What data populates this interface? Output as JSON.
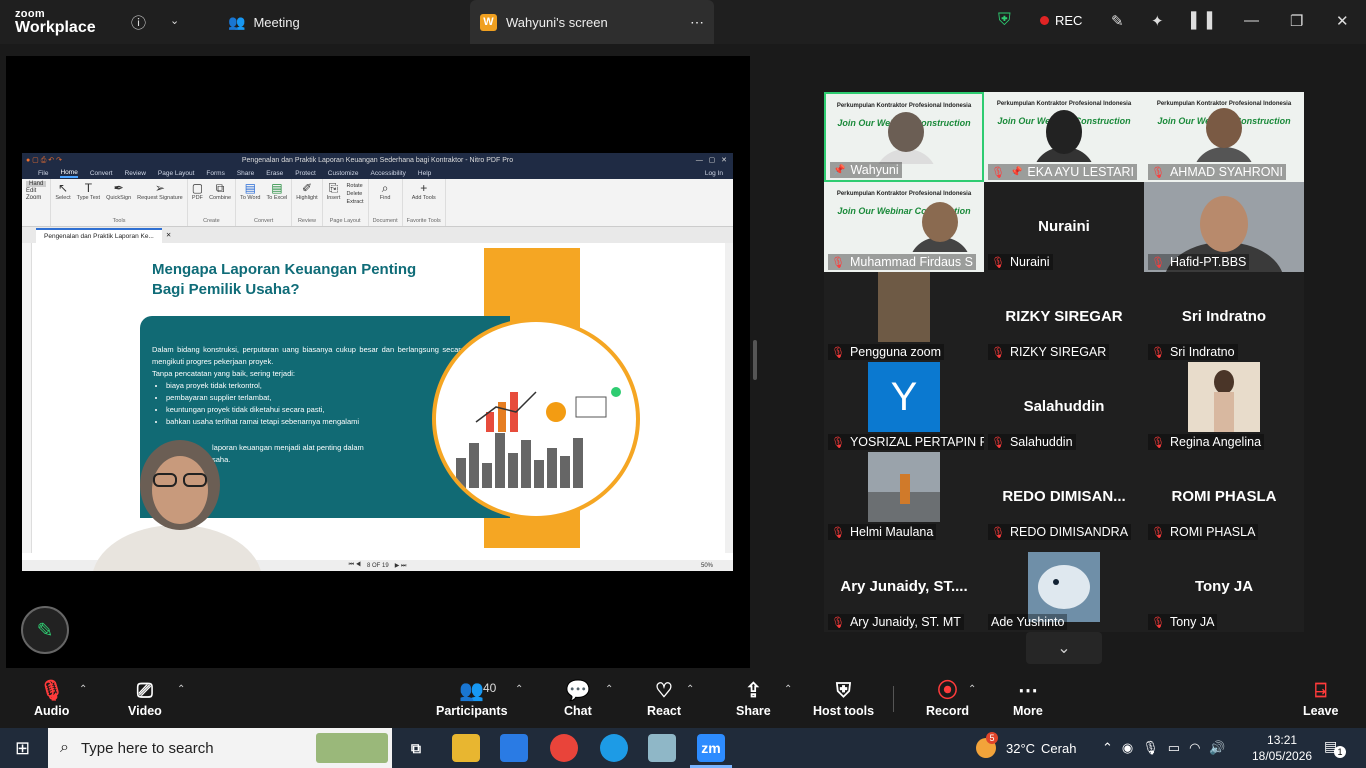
{
  "app": {
    "logo_line1": "zoom",
    "logo_line2": "Workplace"
  },
  "topbar": {
    "tabs": [
      {
        "label": "Meeting",
        "icon": "people-icon"
      },
      {
        "label": "Wahyuni's screen",
        "badge": "W",
        "icon": "screen-share-icon"
      }
    ],
    "rec_label": "REC",
    "colors": {
      "accent_green": "#2ecc71",
      "rec_red": "#e02424",
      "badge_orange": "#f0a020"
    }
  },
  "nitro": {
    "window_title": "Pengenalan dan Praktik Laporan Keuangan Sederhana bagi Kontraktor - Nitro PDF Pro",
    "menu": [
      "File",
      "Home",
      "Convert",
      "Review",
      "Page Layout",
      "Forms",
      "Share",
      "Erase",
      "Protect",
      "Customize",
      "Accessibility",
      "Help"
    ],
    "login": "Log In",
    "left_tools": [
      "Hand",
      "Edit",
      "Zoom"
    ],
    "ribbon_groups": [
      {
        "name": "Tools",
        "buttons": [
          "Select",
          "Type Text",
          "QuickSign",
          "Request Signature"
        ]
      },
      {
        "name": "Create",
        "buttons": [
          "PDF",
          "Combine"
        ]
      },
      {
        "name": "Convert",
        "buttons": [
          "To Word",
          "To Excel"
        ]
      },
      {
        "name": "Review",
        "buttons": [
          "Highlight"
        ]
      },
      {
        "name": "Page Layout",
        "buttons": [
          "Insert",
          "Rotate",
          "Delete",
          "Extract"
        ]
      },
      {
        "name": "Document",
        "buttons": [
          "Find"
        ]
      },
      {
        "name": "Favorite Tools",
        "buttons": [
          "Add Tools"
        ]
      }
    ],
    "doc_tab": "Pengenalan dan Praktik Laporan Ke...",
    "slide_title": "Mengapa Laporan Keuangan Penting Bagi Pemilik Usaha?",
    "slide_intro": "Dalam bidang konstruksi, perputaran uang biasanya cukup besar dan berlangsung secara bertahap mengikuti progres pekerjaan proyek.",
    "slide_lead": "Tanpa pencatatan yang baik, sering terjadi:",
    "slide_bullets": [
      "biaya proyek tidak terkontrol,",
      "pembayaran supplier terlambat,",
      "keuntungan proyek tidak diketahui secara pasti,",
      "bahkan usaha terlihat ramai tetapi sebenarnya mengalami"
    ],
    "slide_closing": "laporan keuangan menjadi alat penting dalam",
    "slide_closing2": "saha.",
    "page_indicator": "8 OF 19",
    "zoom": "50%"
  },
  "gallery": {
    "webinar_line1": "Perkumpulan Kontraktor Profesional Indonesia",
    "webinar_line2": "Join Our Webinar Construction",
    "tiles": [
      {
        "name": "Wahyuni",
        "type": "webinar",
        "pinned": true
      },
      {
        "name": "EKA AYU LESTARI",
        "type": "webinar",
        "pinned": true
      },
      {
        "name": "AHMAD SYAHRONI",
        "type": "webinar"
      },
      {
        "name": "Muhammad Firdaus S",
        "type": "webinar"
      },
      {
        "name": "Nuraini",
        "big": "Nuraini"
      },
      {
        "name": "Hafid-PT.BBS",
        "type": "video"
      },
      {
        "name": "Pengguna zoom",
        "type": "photo"
      },
      {
        "name": "RIZKY SIREGAR",
        "big": "RIZKY SIREGAR"
      },
      {
        "name": "Sri Indratno",
        "big": "Sri Indratno"
      },
      {
        "name": "YOSRIZAL PERTAPIN R...",
        "type": "avatar",
        "letter": "Y"
      },
      {
        "name": "Salahuddin",
        "big": "Salahuddin"
      },
      {
        "name": "Regina Angelina",
        "type": "photo"
      },
      {
        "name": "Helmi Maulana",
        "type": "photo"
      },
      {
        "name": "REDO DIMISANDRA",
        "big": "REDO DIMISAN..."
      },
      {
        "name": "ROMI PHASLA",
        "big": "ROMI PHASLA"
      },
      {
        "name": "Ary Junaidy, ST. MT",
        "big": "Ary Junaidy, ST...."
      },
      {
        "name": "Ade Yushinto",
        "type": "photo",
        "unmuted": true
      },
      {
        "name": "Tony JA",
        "big": "Tony JA"
      }
    ]
  },
  "toolbar": {
    "audio": "Audio",
    "video": "Video",
    "participants": "Participants",
    "participants_count": "40",
    "chat": "Chat",
    "react": "React",
    "share": "Share",
    "host_tools": "Host tools",
    "record": "Record",
    "more": "More",
    "leave": "Leave"
  },
  "taskbar": {
    "search_placeholder": "Type here to search",
    "weather_temp": "32°C",
    "weather_text": "Cerah",
    "weather_badge": "5",
    "time": "13:21",
    "date": "18/05/2026",
    "notif_count": "1",
    "app_label_zoom": "zm"
  }
}
